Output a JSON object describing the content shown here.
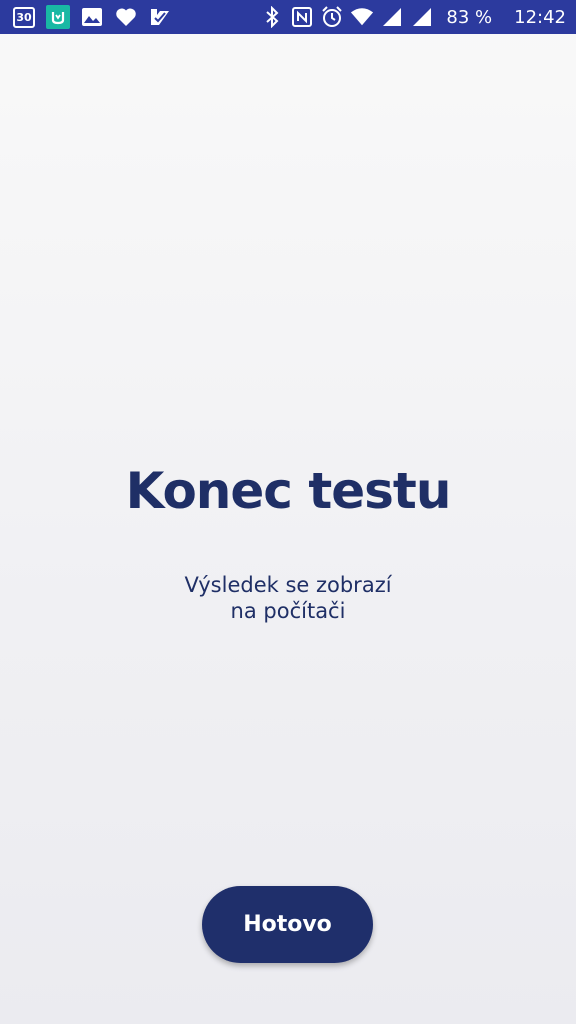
{
  "status_bar": {
    "calendar_day": "30",
    "battery": "83 %",
    "time": "12:42",
    "background_color": "#2c3a9e",
    "left_icons": [
      "calendar-icon",
      "mi-fit-icon",
      "gallery-icon",
      "heart-icon",
      "checkmark-app-icon"
    ],
    "right_icons": [
      "bluetooth-icon",
      "nfc-icon",
      "alarm-icon",
      "wifi-icon",
      "signal-icon",
      "signal-icon-2"
    ]
  },
  "main": {
    "title": "Konec testu",
    "subtitle_line1": "Výsledek se zobrazí",
    "subtitle_line2": "na počítači",
    "text_color": "#1f2f66"
  },
  "footer": {
    "done_label": "Hotovo",
    "button_color": "#1f2f6b"
  }
}
